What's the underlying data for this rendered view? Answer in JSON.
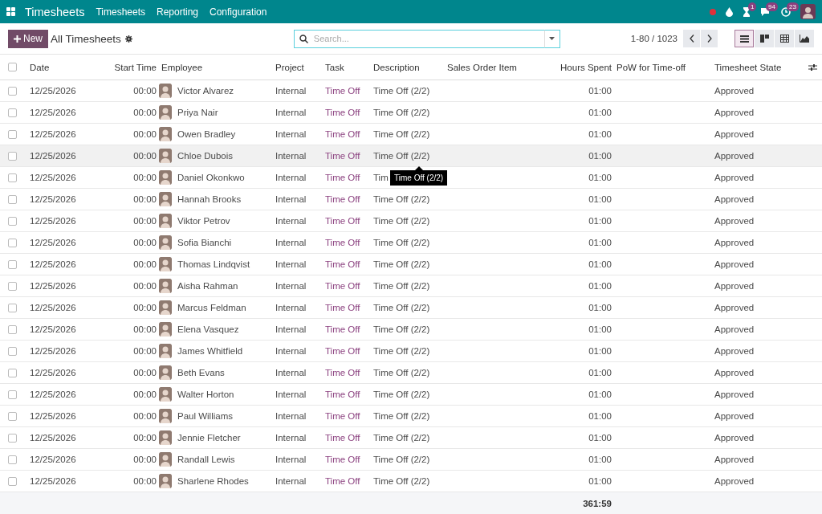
{
  "topbar": {
    "app": "Timesheets",
    "menu": [
      "Timesheets",
      "Reporting",
      "Configuration"
    ],
    "systray": [
      {
        "kind": "status"
      },
      {
        "kind": "drop"
      },
      {
        "kind": "activity",
        "badge": "1"
      },
      {
        "kind": "messages",
        "badge": "94"
      },
      {
        "kind": "clock",
        "badge": "23"
      },
      {
        "kind": "avatar"
      }
    ]
  },
  "control": {
    "new_button": "New",
    "breadcrumb": "All Timesheets",
    "search": {
      "placeholder": "Search..."
    },
    "pager": "1-80 / 1023",
    "views": [
      {
        "kind": "list",
        "selected": true
      },
      {
        "kind": "kanban",
        "selected": false
      },
      {
        "kind": "pivot",
        "selected": false
      },
      {
        "kind": "graph",
        "selected": false
      }
    ]
  },
  "table": {
    "select_all_checked": false,
    "columns": [
      "Date",
      "Start Time",
      "Employee",
      "Project",
      "Task",
      "Description",
      "Sales Order Item",
      "Hours Spent",
      "PoW for Time-off",
      "Timesheet State"
    ],
    "rows": [
      {
        "date": "12/25/2026",
        "start": "00:00",
        "employee": "Victor Alvarez",
        "project": "Internal",
        "task": "Time Off",
        "description": "Time Off (2/2)",
        "hours": "01:00",
        "state": "Approved",
        "checked": false,
        "hovered": false
      },
      {
        "date": "12/25/2026",
        "start": "00:00",
        "employee": "Priya Nair",
        "project": "Internal",
        "task": "Time Off",
        "description": "Time Off (2/2)",
        "hours": "01:00",
        "state": "Approved",
        "checked": false,
        "hovered": false
      },
      {
        "date": "12/25/2026",
        "start": "00:00",
        "employee": "Owen Bradley",
        "project": "Internal",
        "task": "Time Off",
        "description": "Time Off (2/2)",
        "hours": "01:00",
        "state": "Approved",
        "checked": false,
        "hovered": false
      },
      {
        "date": "12/25/2026",
        "start": "00:00",
        "employee": "Chloe Dubois",
        "project": "Internal",
        "task": "Time Off",
        "description": "Time Off (2/2)",
        "hours": "01:00",
        "state": "Approved",
        "checked": false,
        "hovered": true
      },
      {
        "date": "12/25/2026",
        "start": "00:00",
        "employee": "Daniel Okonkwo",
        "project": "Internal",
        "task": "Time Off",
        "description": "Tim",
        "hours": "01:00",
        "state": "Approved",
        "checked": false,
        "hovered": false,
        "tooltip": "Time Off (2/2)"
      },
      {
        "date": "12/25/2026",
        "start": "00:00",
        "employee": "Hannah Brooks",
        "project": "Internal",
        "task": "Time Off",
        "description": "Time Off (2/2)",
        "hours": "01:00",
        "state": "Approved",
        "checked": false,
        "hovered": false
      },
      {
        "date": "12/25/2026",
        "start": "00:00",
        "employee": "Viktor Petrov",
        "project": "Internal",
        "task": "Time Off",
        "description": "Time Off (2/2)",
        "hours": "01:00",
        "state": "Approved",
        "checked": false,
        "hovered": false
      },
      {
        "date": "12/25/2026",
        "start": "00:00",
        "employee": "Sofia Bianchi",
        "project": "Internal",
        "task": "Time Off",
        "description": "Time Off (2/2)",
        "hours": "01:00",
        "state": "Approved",
        "checked": false,
        "hovered": false
      },
      {
        "date": "12/25/2026",
        "start": "00:00",
        "employee": "Thomas Lindqvist",
        "project": "Internal",
        "task": "Time Off",
        "description": "Time Off (2/2)",
        "hours": "01:00",
        "state": "Approved",
        "checked": false,
        "hovered": false
      },
      {
        "date": "12/25/2026",
        "start": "00:00",
        "employee": "Aisha Rahman",
        "project": "Internal",
        "task": "Time Off",
        "description": "Time Off (2/2)",
        "hours": "01:00",
        "state": "Approved",
        "checked": false,
        "hovered": false
      },
      {
        "date": "12/25/2026",
        "start": "00:00",
        "employee": "Marcus Feldman",
        "project": "Internal",
        "task": "Time Off",
        "description": "Time Off (2/2)",
        "hours": "01:00",
        "state": "Approved",
        "checked": false,
        "hovered": false
      },
      {
        "date": "12/25/2026",
        "start": "00:00",
        "employee": "Elena Vasquez",
        "project": "Internal",
        "task": "Time Off",
        "description": "Time Off (2/2)",
        "hours": "01:00",
        "state": "Approved",
        "checked": false,
        "hovered": false
      },
      {
        "date": "12/25/2026",
        "start": "00:00",
        "employee": "James Whitfield",
        "project": "Internal",
        "task": "Time Off",
        "description": "Time Off (2/2)",
        "hours": "01:00",
        "state": "Approved",
        "checked": false,
        "hovered": false
      },
      {
        "date": "12/25/2026",
        "start": "00:00",
        "employee": "Beth Evans",
        "project": "Internal",
        "task": "Time Off",
        "description": "Time Off (2/2)",
        "hours": "01:00",
        "state": "Approved",
        "checked": false,
        "hovered": false
      },
      {
        "date": "12/25/2026",
        "start": "00:00",
        "employee": "Walter Horton",
        "project": "Internal",
        "task": "Time Off",
        "description": "Time Off (2/2)",
        "hours": "01:00",
        "state": "Approved",
        "checked": false,
        "hovered": false
      },
      {
        "date": "12/25/2026",
        "start": "00:00",
        "employee": "Paul Williams",
        "project": "Internal",
        "task": "Time Off",
        "description": "Time Off (2/2)",
        "hours": "01:00",
        "state": "Approved",
        "checked": false,
        "hovered": false
      },
      {
        "date": "12/25/2026",
        "start": "00:00",
        "employee": "Jennie Fletcher",
        "project": "Internal",
        "task": "Time Off",
        "description": "Time Off (2/2)",
        "hours": "01:00",
        "state": "Approved",
        "checked": false,
        "hovered": false
      },
      {
        "date": "12/25/2026",
        "start": "00:00",
        "employee": "Randall Lewis",
        "project": "Internal",
        "task": "Time Off",
        "description": "Time Off (2/2)",
        "hours": "01:00",
        "state": "Approved",
        "checked": false,
        "hovered": false
      },
      {
        "date": "12/25/2026",
        "start": "00:00",
        "employee": "Sharlene Rhodes",
        "project": "Internal",
        "task": "Time Off",
        "description": "Time Off (2/2)",
        "hours": "01:00",
        "state": "Approved",
        "checked": false,
        "hovered": false
      }
    ],
    "total": "361:59"
  }
}
